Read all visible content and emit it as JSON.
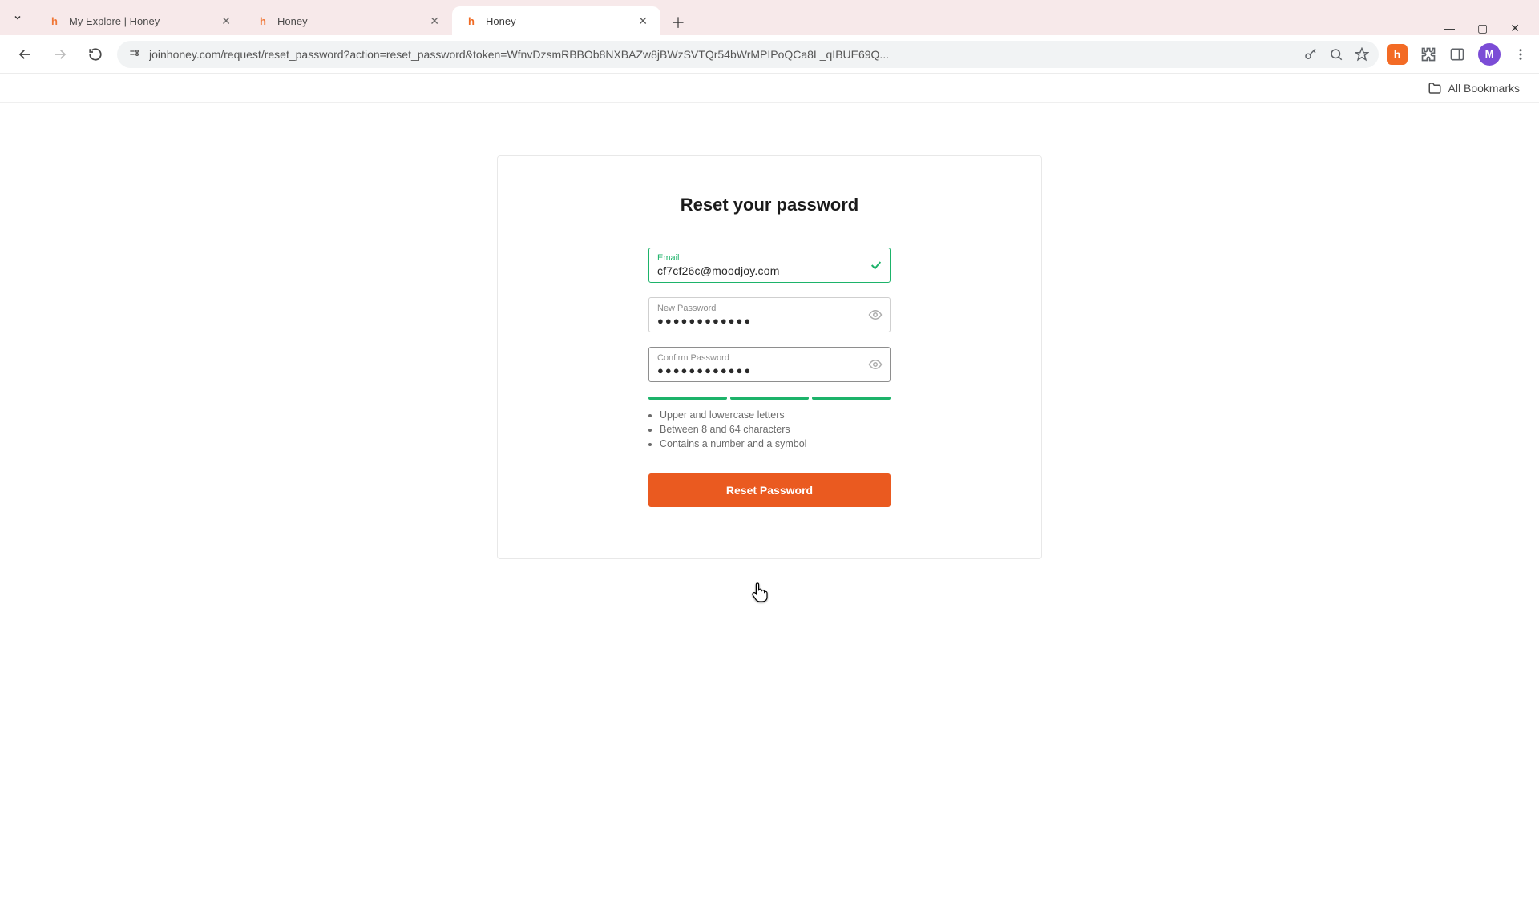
{
  "browser": {
    "tabs": [
      {
        "title": "My Explore | Honey",
        "active": false
      },
      {
        "title": "Honey",
        "active": false
      },
      {
        "title": "Honey",
        "active": true
      }
    ],
    "url": "joinhoney.com/request/reset_password?action=reset_password&token=WfnvDzsmRBBOb8NXBAZw8jBWzSVTQr54bWrMPIPoQCa8L_qIBUE69Q...",
    "bookmarks_label": "All Bookmarks",
    "profile_initial": "M",
    "honey_ext_initial": "h"
  },
  "form": {
    "title": "Reset your password",
    "email": {
      "label": "Email",
      "value": "cf7cf26c@moodjoy.com",
      "valid": true
    },
    "new_password": {
      "label": "New Password",
      "value": "●●●●●●●●●●●●",
      "masked": true
    },
    "confirm_password": {
      "label": "Confirm Password",
      "value": "●●●●●●●●●●●●",
      "masked": true,
      "focused": true
    },
    "strength_segments": 3,
    "rules": [
      "Upper and lowercase letters",
      "Between 8 and 64 characters",
      "Contains a number and a symbol"
    ],
    "submit_label": "Reset Password"
  },
  "colors": {
    "accent": "#ea5a20",
    "success": "#1db36a"
  }
}
